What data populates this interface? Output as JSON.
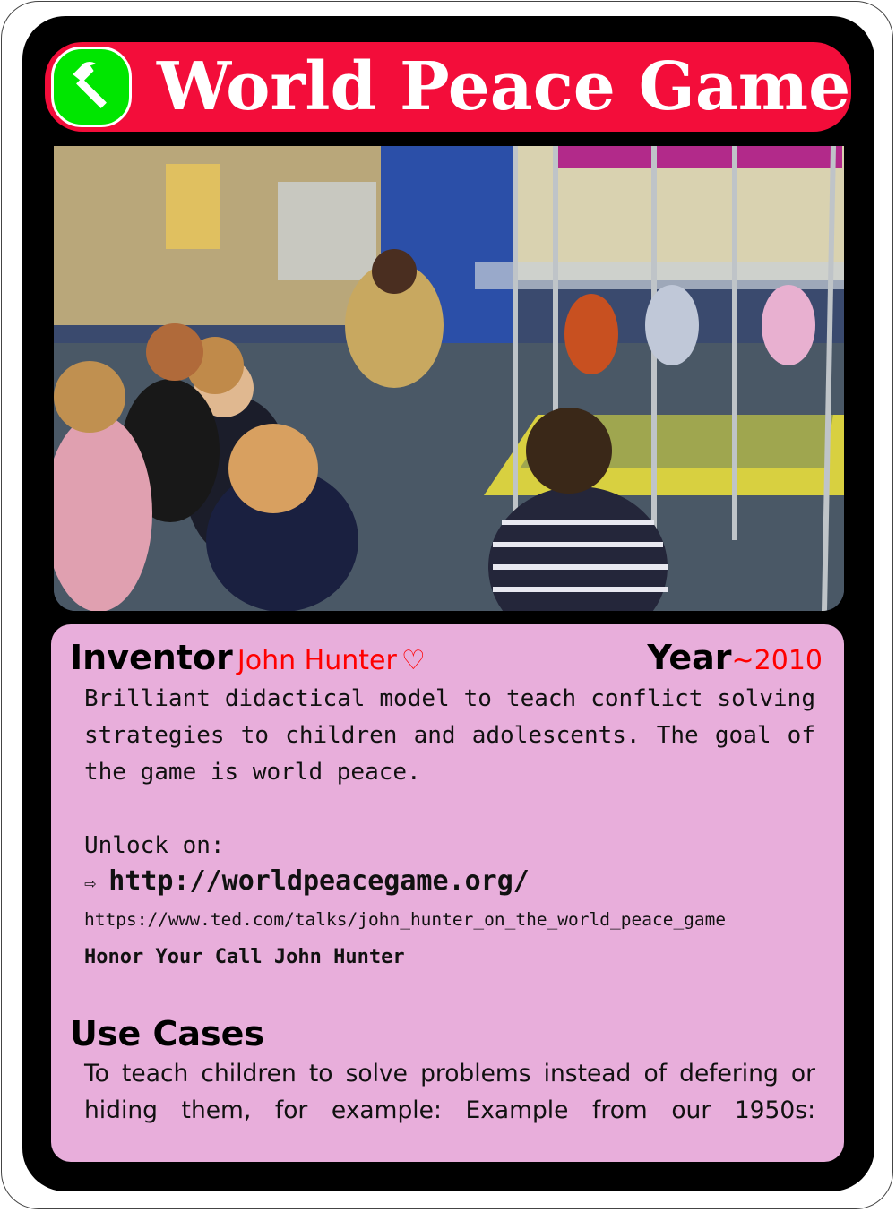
{
  "card": {
    "title": "World Peace Game",
    "category_icon": "hammer-icon",
    "colors": {
      "header": "#f30d3a",
      "icon_bg": "#00e600",
      "panel": "#e8aedb",
      "accent": "#ff0000"
    }
  },
  "photo": {
    "description_icon": "classroom-photo"
  },
  "info": {
    "inventor_label": "Inventor",
    "inventor_name": "John Hunter",
    "heart": "♡",
    "year_label": "Year",
    "year_value": "~2010",
    "description": "Brilliant didactical model to teach conflict solving strategies to children and adolescents. The goal of the game is world peace.",
    "unlock_label": "Unlock on:",
    "arrow": "⇨",
    "primary_link": "http://worldpeacegame.org/",
    "secondary_link": "https://www.ted.com/talks/john_hunter_on_the_world_peace_game",
    "tagline": "Honor Your Call John Hunter"
  },
  "use_cases": {
    "title": "Use Cases",
    "text": "To teach children to solve problems instead of defering or hiding them, for example: Example from our 1950s:"
  }
}
